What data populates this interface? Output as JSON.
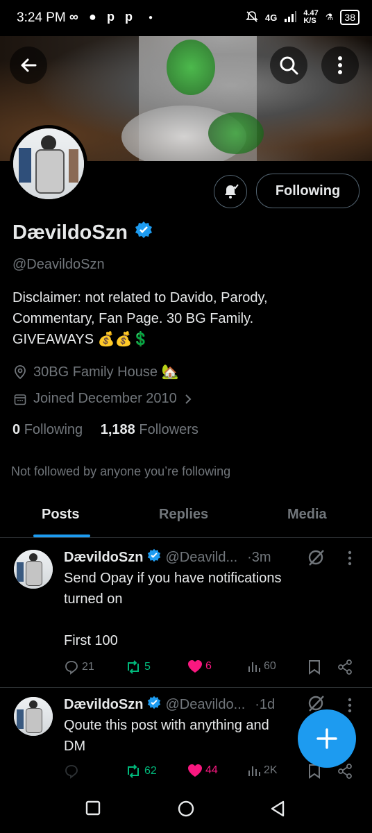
{
  "status_bar": {
    "time": "3:24 PM",
    "network": "4G",
    "speed": "4.47",
    "speed_unit": "K/S",
    "battery": "38"
  },
  "header": {
    "back_icon": "arrow-left-icon",
    "search_icon": "search-icon",
    "more_icon": "more-vertical-icon"
  },
  "profile": {
    "display_name": "DævildoSzn",
    "handle": "@DeavildoSzn",
    "bio_lines": [
      "Disclaimer: not related to Davido, Parody,",
      "Commentary, Fan Page. 30 BG Family.",
      "GIVEAWAYS 💰💰💲"
    ],
    "location": "30BG Family House 🏡",
    "joined": "Joined December 2010",
    "following_count": "0",
    "following_label": "Following",
    "followers_count": "1,188",
    "followers_label": "Followers",
    "not_followed_text": "Not followed by anyone you’re following",
    "follow_button_label": "Following",
    "verified_color": "#1d9bf0"
  },
  "tabs": [
    {
      "label": "Posts",
      "active": true
    },
    {
      "label": "Replies",
      "active": false
    },
    {
      "label": "Media",
      "active": false
    }
  ],
  "posts": [
    {
      "name": "DævildoSzn",
      "handle": "@Deavild...",
      "time": "·3m",
      "text_lines": [
        "Send Opay if you have notifications",
        "turned on",
        "",
        "First 100"
      ],
      "replies": "21",
      "reposts": "5",
      "likes": "6",
      "views": "60"
    },
    {
      "name": "DævildoSzn",
      "handle": "@Deavildo...",
      "time": "·1d",
      "text_lines": [
        "Qoute this post with anything and",
        "DM"
      ],
      "replies": "",
      "reposts": "62",
      "likes": "44",
      "views": "2K"
    }
  ],
  "fab": {
    "icon": "plus-icon"
  },
  "colors": {
    "accent": "#1d9bf0",
    "repost": "#00ba7c",
    "like": "#f91880",
    "muted": "#71767b"
  }
}
